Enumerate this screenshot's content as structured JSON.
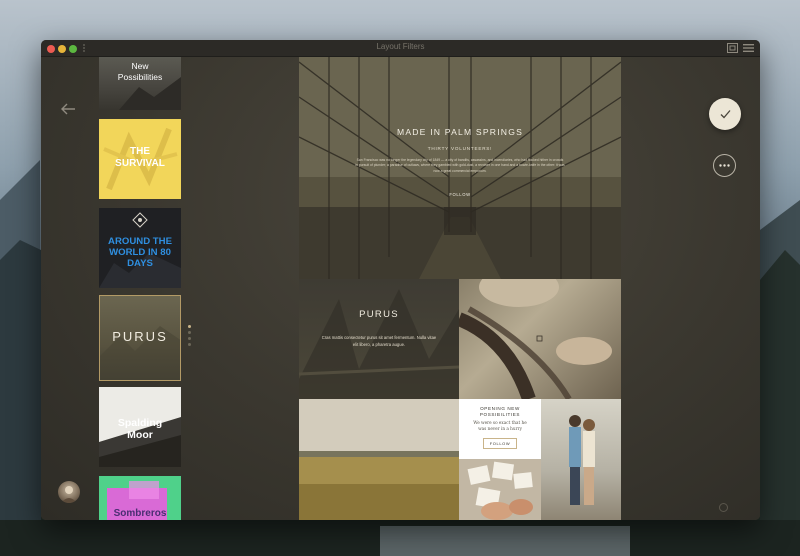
{
  "window": {
    "title": "Layout Filters"
  },
  "sidebar": {
    "thumbnails": [
      {
        "label": "New Possibilities"
      },
      {
        "label": "THE SURVIVAL"
      },
      {
        "label": "AROUND THE WORLD IN 80 DAYS"
      },
      {
        "label": "PURUS"
      },
      {
        "label": "Spalding Moor"
      },
      {
        "label": "Sombreros"
      }
    ]
  },
  "hero": {
    "title": "MADE IN PALM SPRINGS",
    "subtitle": "THIRTY VOLUNTEERS!",
    "body": "San Francisco was no longer the legendary city of 1849 — a city of bandits, assassins, and incendiaries, who had flocked hither in crowds in pursuit of plunder; a paradise of outlaws, where they gambled with gold-dust, a revolver in one hand and a bowie-knife in the other: it was now a great commercial emporium.",
    "button": "FOLLOW"
  },
  "tiles": {
    "purus": {
      "title": "PURUS",
      "body": "Cras mattis consectetur purus sit amet fermentum. Nulla vitae elit libero, a pharetra augue."
    },
    "opening": {
      "title": "OPENING NEW POSSIBILITIES",
      "body": "We were so exact that he was never in a hurry",
      "button": "FOLLOW"
    }
  },
  "colors": {
    "accent": "#c9b48a",
    "window": "#3a3730",
    "yellow": "#f2d65a",
    "blue": "#2f8fe0"
  }
}
